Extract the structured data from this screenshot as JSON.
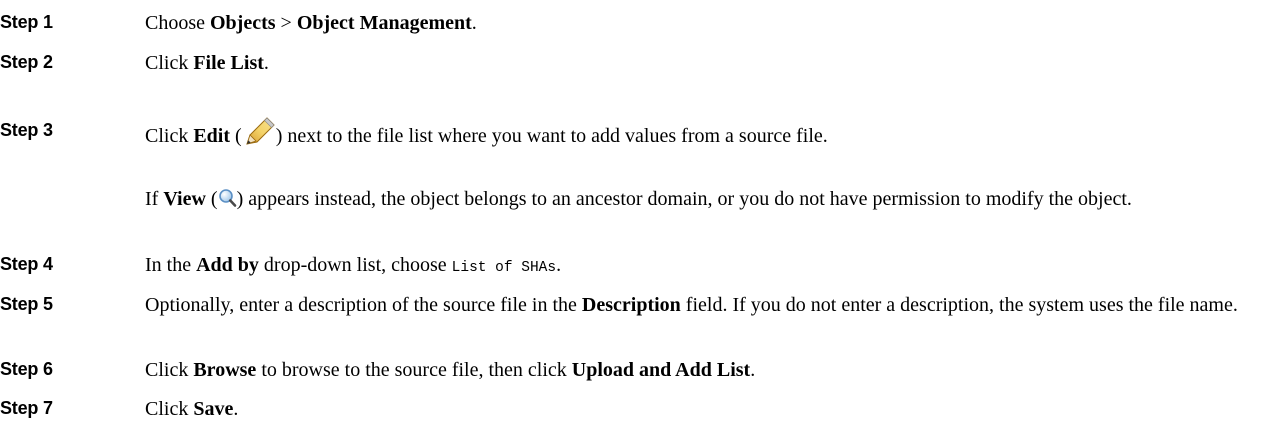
{
  "steps": [
    {
      "label": "Step 1",
      "parts": [
        {
          "t": "Choose "
        },
        {
          "b": "Objects"
        },
        {
          "t": " > "
        },
        {
          "b": "Object Management"
        },
        {
          "t": "."
        }
      ]
    },
    {
      "label": "Step 2",
      "parts": [
        {
          "t": "Click "
        },
        {
          "b": "File List"
        },
        {
          "t": "."
        }
      ]
    },
    {
      "label": "Step 3",
      "parts": [
        {
          "t": "Click "
        },
        {
          "b": "Edit"
        },
        {
          "t": " ("
        },
        {
          "icon": "pencil-icon"
        },
        {
          "t": ") next to the file list where you want to add values from a source file."
        }
      ]
    },
    {
      "label": "",
      "parts": [
        {
          "t": "If "
        },
        {
          "b": "View"
        },
        {
          "t": " ("
        },
        {
          "icon": "magnifier-icon"
        },
        {
          "t": ") appears instead, the object belongs to an ancestor domain, or you do not have permission to modify the object."
        }
      ]
    },
    {
      "label": "Step 4",
      "parts": [
        {
          "t": "In the "
        },
        {
          "b": "Add by"
        },
        {
          "t": " drop-down list, choose "
        },
        {
          "code": "List of SHAs"
        },
        {
          "t": "."
        }
      ]
    },
    {
      "label": "Step 5",
      "parts": [
        {
          "t": "Optionally, enter a description of the source file in the "
        },
        {
          "b": "Description"
        },
        {
          "t": " field. If you do not enter a description, the system uses the file name."
        }
      ]
    },
    {
      "label": "Step 6",
      "parts": [
        {
          "t": "Click "
        },
        {
          "b": "Browse"
        },
        {
          "t": " to browse to the source file, then click "
        },
        {
          "b": "Upload and Add List"
        },
        {
          "t": "."
        }
      ]
    },
    {
      "label": "Step 7",
      "parts": [
        {
          "t": "Click "
        },
        {
          "b": "Save"
        },
        {
          "t": "."
        }
      ]
    }
  ]
}
